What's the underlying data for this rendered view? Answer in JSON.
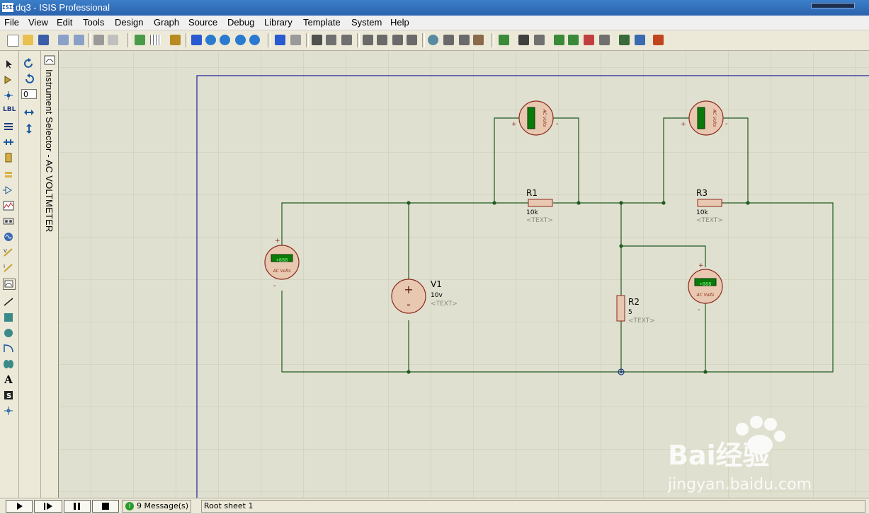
{
  "window": {
    "title": "dq3 - ISIS Professional",
    "app_icon_text": "ISIS"
  },
  "menu": [
    "File",
    "View",
    "Edit",
    "Tools",
    "Design",
    "Graph",
    "Source",
    "Debug",
    "Library",
    "Template",
    "System",
    "Help"
  ],
  "rotation_value": "0",
  "selector_title": "Instrument Selector - AC VOLTMETER",
  "schematic": {
    "r1": {
      "ref": "R1",
      "value": "10k",
      "text": "<TEXT>"
    },
    "r3": {
      "ref": "R3",
      "value": "10k",
      "text": "<TEXT>"
    },
    "r2": {
      "ref": "R2",
      "value": "5",
      "text": "<TEXT>"
    },
    "v1": {
      "ref": "V1",
      "value": "10v",
      "text": "<TEXT>"
    },
    "voltmeter_label": "AC Volts",
    "voltmeter_display": "+888",
    "plus": "+",
    "minus": "-"
  },
  "status": {
    "messages": "9 Message(s)",
    "sheet": "Root sheet 1"
  },
  "watermark": {
    "brand": "Bai经验",
    "url": "jingyan.baidu.com"
  },
  "colors": {
    "wire": "#1f5a1f",
    "grid": "#c8c8b4",
    "sheet_border": "#2020a0",
    "component_fill": "#e8c8b0",
    "component_stroke": "#8c2a1e",
    "meter_screen": "#0a7a0a"
  }
}
